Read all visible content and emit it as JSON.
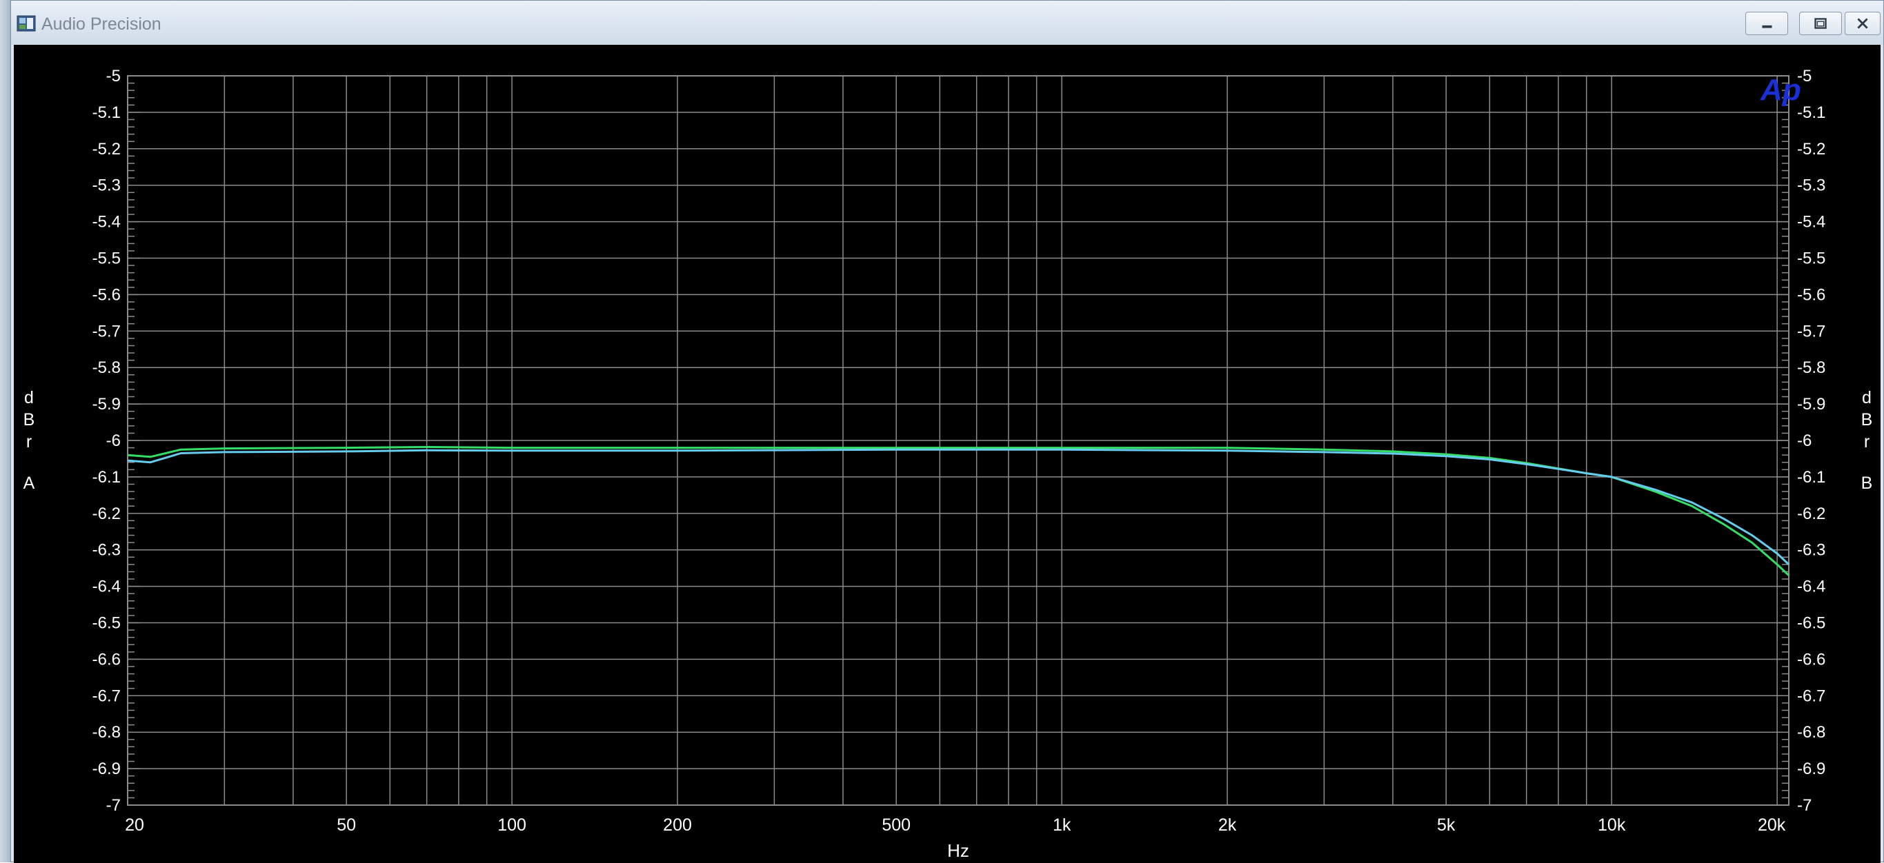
{
  "window": {
    "title": "Audio Precision",
    "icons": {
      "app": "audio-precision-app-icon",
      "minimize": "minimize-icon",
      "maximize": "maximize-icon",
      "close": "close-icon"
    }
  },
  "logo_text": "Ap",
  "colors": {
    "background": "#000000",
    "grid": "#8c8c8c",
    "text": "#ffffff",
    "logo": "#1a2fd6",
    "series_green": "#33dd66",
    "series_cyan": "#66ccee"
  },
  "chart_data": {
    "type": "line",
    "x_scale": "log",
    "xlim": [
      20,
      21000
    ],
    "ylim": [
      -7,
      -5
    ],
    "xlabel": "Hz",
    "ylabel_left": [
      "d",
      "B",
      "r",
      "A"
    ],
    "ylabel_right": [
      "d",
      "B",
      "r",
      "B"
    ],
    "x_ticks": [
      {
        "value": 20,
        "label": "20"
      },
      {
        "value": 50,
        "label": "50"
      },
      {
        "value": 100,
        "label": "100"
      },
      {
        "value": 200,
        "label": "200"
      },
      {
        "value": 500,
        "label": "500"
      },
      {
        "value": 1000,
        "label": "1k"
      },
      {
        "value": 2000,
        "label": "2k"
      },
      {
        "value": 5000,
        "label": "5k"
      },
      {
        "value": 10000,
        "label": "10k"
      },
      {
        "value": 20000,
        "label": "20k"
      }
    ],
    "x_grid": [
      20,
      30,
      40,
      50,
      60,
      70,
      80,
      90,
      100,
      200,
      300,
      400,
      500,
      600,
      700,
      800,
      900,
      1000,
      2000,
      3000,
      4000,
      5000,
      6000,
      7000,
      8000,
      9000,
      10000,
      20000
    ],
    "y_ticks": [
      -5,
      -5.1,
      -5.2,
      -5.3,
      -5.4,
      -5.5,
      -5.6,
      -5.7,
      -5.8,
      -5.9,
      -6,
      -6.1,
      -6.2,
      -6.3,
      -6.4,
      -6.5,
      -6.6,
      -6.7,
      -6.8,
      -6.9,
      -7
    ],
    "y_tick_labels": [
      "-5",
      "-5.1",
      "-5.2",
      "-5.3",
      "-5.4",
      "-5.5",
      "-5.6",
      "-5.7",
      "-5.8",
      "-5.9",
      "-6",
      "-6.1",
      "-6.2",
      "-6.3",
      "-6.4",
      "-6.5",
      "-6.6",
      "-6.7",
      "-6.8",
      "-6.9",
      "-7"
    ],
    "grid": true,
    "series": [
      {
        "color": "#33dd66",
        "x": [
          20,
          22,
          25,
          30,
          50,
          70,
          100,
          200,
          500,
          1000,
          2000,
          3000,
          4000,
          5000,
          6000,
          7000,
          8000,
          9000,
          10000,
          12000,
          14000,
          16000,
          18000,
          20000,
          21000
        ],
        "y": [
          -6.04,
          -6.045,
          -6.025,
          -6.022,
          -6.02,
          -6.018,
          -6.02,
          -6.02,
          -6.02,
          -6.02,
          -6.02,
          -6.025,
          -6.03,
          -6.038,
          -6.048,
          -6.062,
          -6.077,
          -6.09,
          -6.1,
          -6.14,
          -6.18,
          -6.23,
          -6.28,
          -6.34,
          -6.37
        ]
      },
      {
        "color": "#66ccee",
        "x": [
          20,
          22,
          25,
          30,
          50,
          70,
          100,
          200,
          500,
          1000,
          2000,
          3000,
          4000,
          5000,
          6000,
          7000,
          8000,
          9000,
          10000,
          12000,
          14000,
          16000,
          18000,
          20000,
          21000
        ],
        "y": [
          -6.055,
          -6.06,
          -6.035,
          -6.032,
          -6.03,
          -6.027,
          -6.028,
          -6.028,
          -6.025,
          -6.025,
          -6.028,
          -6.032,
          -6.036,
          -6.043,
          -6.052,
          -6.065,
          -6.078,
          -6.09,
          -6.1,
          -6.135,
          -6.17,
          -6.215,
          -6.26,
          -6.31,
          -6.34
        ]
      }
    ]
  }
}
